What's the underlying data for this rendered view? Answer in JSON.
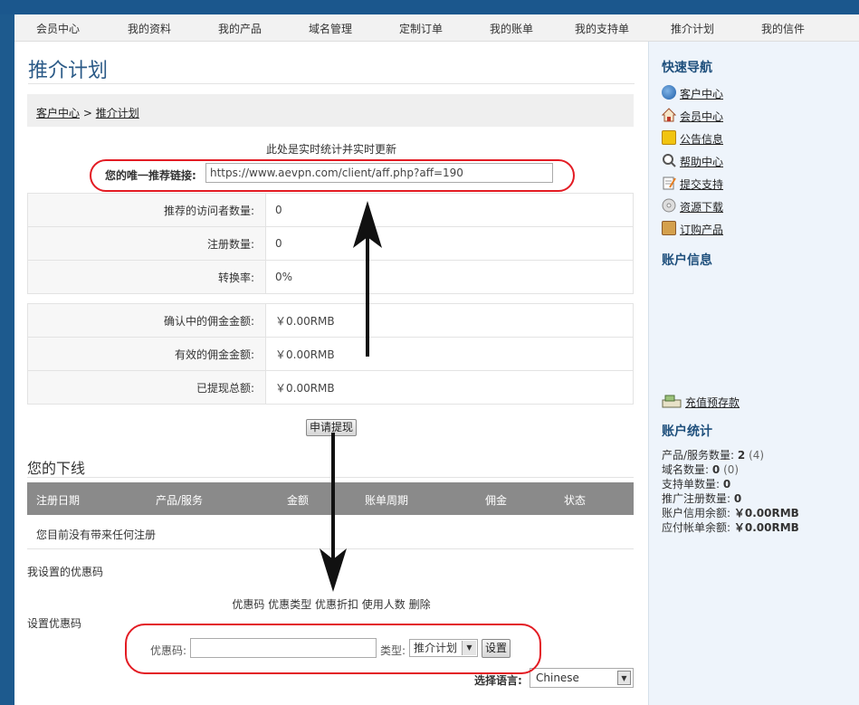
{
  "nav": [
    "会员中心",
    "我的资料",
    "我的产品",
    "域名管理",
    "定制订单",
    "我的账单",
    "我的支持单",
    "推介计划",
    "我的信件"
  ],
  "page": {
    "title": "推介计划",
    "breadcrumb": {
      "home": "客户中心",
      "sep": ">",
      "current": "推介计划"
    },
    "realtime_note": "此处是实时统计并实时更新",
    "reflink_label": "您的唯一推荐链接:",
    "reflink_value": "https://www.aevpn.com/client/aff.php?aff=190",
    "stats": [
      {
        "label": "推荐的访问者数量:",
        "value": "0"
      },
      {
        "label": "注册数量:",
        "value": "0"
      },
      {
        "label": "转换率:",
        "value": "0%"
      }
    ],
    "commissions": [
      {
        "label": "确认中的佣金金额:",
        "value": "￥0.00RMB"
      },
      {
        "label": "有效的佣金金额:",
        "value": "￥0.00RMB"
      },
      {
        "label": "已提现总额:",
        "value": "￥0.00RMB"
      }
    ],
    "withdraw_button": "申请提现"
  },
  "downline": {
    "title": "您的下线",
    "columns": [
      "注册日期",
      "产品/服务",
      "金额",
      "账单周期",
      "佣金",
      "状态"
    ],
    "empty_text": "您目前没有带来任何注册"
  },
  "coupons": {
    "my_codes_label": "我设置的优惠码",
    "columns_text": "优惠码 优惠类型 优惠折扣 使用人数 删除",
    "set_label": "设置优惠码",
    "code_label": "优惠码:",
    "type_label": "类型:",
    "type_selected": "推介计划",
    "set_button": "设置"
  },
  "language": {
    "label": "选择语言:",
    "selected": "Chinese"
  },
  "sidebar": {
    "quicknav_title": "快速导航",
    "links": [
      {
        "label": "客户中心",
        "icon": "globe-icon"
      },
      {
        "label": "会员中心",
        "icon": "home-icon"
      },
      {
        "label": "公告信息",
        "icon": "announcement-icon"
      },
      {
        "label": "帮助中心",
        "icon": "magnifier-icon"
      },
      {
        "label": "提交支持",
        "icon": "notepad-icon"
      },
      {
        "label": "资源下载",
        "icon": "disc-icon"
      },
      {
        "label": "订购产品",
        "icon": "box-icon"
      }
    ],
    "account_info_title": "账户信息",
    "deposit_link": "充值预存款",
    "account_stats_title": "账户统计",
    "account_stats": [
      {
        "label": "产品/服务数量:",
        "value": "2",
        "extra": "(4)"
      },
      {
        "label": "域名数量:",
        "value": "0",
        "extra": "(0)"
      },
      {
        "label": "支持单数量:",
        "value": "0",
        "extra": ""
      },
      {
        "label": "推广注册数量:",
        "value": "0",
        "extra": ""
      },
      {
        "label": "账户信用余额:",
        "value": "￥0.00RMB",
        "extra": ""
      },
      {
        "label": "应付帐单余额:",
        "value": "￥0.00RMB",
        "extra": ""
      }
    ]
  },
  "colors": {
    "accent": "#1e4f7c",
    "annotation": "#e31b23",
    "header_bg": "#1b578d"
  }
}
